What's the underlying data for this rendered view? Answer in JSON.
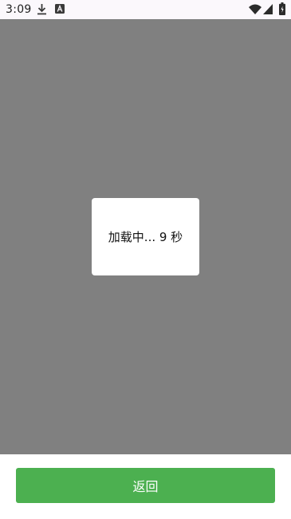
{
  "status_bar": {
    "time": "3:09",
    "icons": [
      "download-icon",
      "a-notification-icon",
      "wifi-icon",
      "signal-icon",
      "battery-icon"
    ]
  },
  "dialog": {
    "loading_text": "加载中... 9 秒"
  },
  "footer": {
    "back_label": "返回"
  },
  "colors": {
    "overlay": "#808080",
    "button": "#4cb050",
    "status_bar_bg": "#fbf8fc"
  }
}
